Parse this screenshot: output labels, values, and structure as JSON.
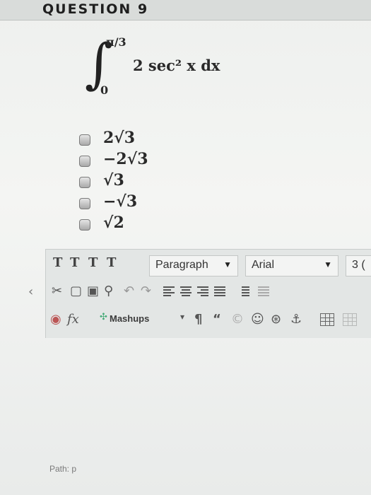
{
  "question": {
    "title": "QUESTION 9"
  },
  "integral": {
    "upper_limit": "π/3",
    "lower_limit": "0",
    "integrand": "2 sec² x dx"
  },
  "choices": [
    "2√3",
    "−2√3",
    "√3",
    "−√3",
    "√2"
  ],
  "editor": {
    "toolbar_row1": {
      "text_buttons": [
        "T",
        "T",
        "T",
        "T"
      ],
      "paragraph_select": "Paragraph",
      "font_select": "Arial",
      "font_size_partial": "3 ("
    },
    "toolbar_row2": {
      "icons": [
        "cut-icon",
        "copy-icon",
        "paste-icon",
        "find-icon",
        "undo-icon",
        "redo-icon",
        "align-left-icon",
        "align-center-icon",
        "align-right-icon",
        "align-justify-icon",
        "list-icon",
        "indent-icon"
      ]
    },
    "toolbar_row3": {
      "fx_label": "fx",
      "mashups_label": "Mashups",
      "paragraph_mark": "¶",
      "quote_mark": "“"
    }
  },
  "footer": {
    "path_label": "Path: p"
  }
}
